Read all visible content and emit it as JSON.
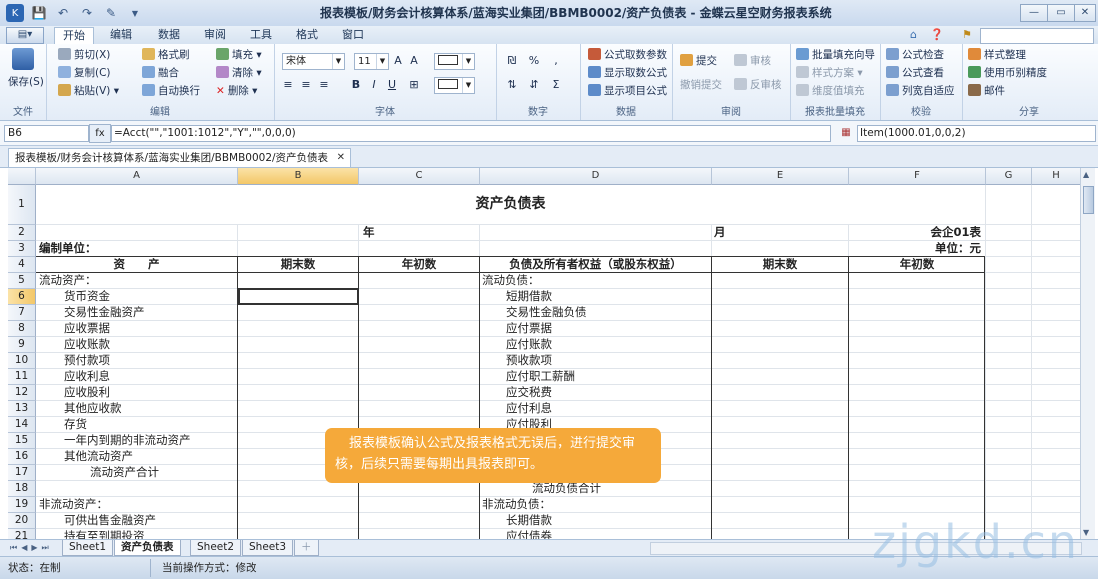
{
  "window": {
    "title": "报表模板/财务会计核算体系/蓝海实业集团/BBMB0002/资产负债表 - 金蝶云星空财务报表系统",
    "minimize": "—",
    "restore": "▭",
    "close": "✕"
  },
  "menu": {
    "app_button": "▤▾",
    "items": [
      "开始",
      "编辑",
      "数据",
      "审阅",
      "工具",
      "格式",
      "窗口"
    ],
    "active": "开始"
  },
  "ribbon": {
    "file": {
      "save": "保存(S)",
      "label": "文件"
    },
    "edit": {
      "cut": "剪切(X)",
      "copy": "复制(C)",
      "paste": "粘贴(V)",
      "format_painter": "格式刷",
      "merge": "融合",
      "wrap": "自动换行",
      "fill": "填充",
      "clear": "清除",
      "delete": "删除",
      "label": "编辑"
    },
    "font": {
      "name": "宋体",
      "size": "11",
      "bold": "B",
      "italic": "I",
      "underline": "U",
      "label": "字体"
    },
    "number": {
      "percent": "%",
      "comma": ",",
      "sum": "Σ",
      "label": "数字"
    },
    "data": {
      "param": "公式取数参数",
      "show_data": "显示取数公式",
      "show_item": "显示项目公式",
      "label": "数据"
    },
    "review": {
      "submit": "提交",
      "audit": "审核",
      "retract": "撤销提交",
      "unaudit": "反审核",
      "label": "审阅"
    },
    "batch": {
      "wizard": "批量填充向导",
      "style": "样式方案",
      "dim": "维度值填充",
      "label": "报表批量填充"
    },
    "check": {
      "formula_check": "公式检查",
      "formula_view": "公式查看",
      "autofit": "列宽自适应",
      "label": "校验"
    },
    "share": {
      "style_clean": "样式整理",
      "currency": "使用币别精度",
      "mail": "邮件",
      "label": "分享"
    }
  },
  "formula": {
    "cell_ref": "B6",
    "fx": "fx",
    "content": "=Acct(\"\",\"1001:1012\",\"Y\",\"\",0,0,0)",
    "right_content": "Item(1000.01,0,0,2)"
  },
  "doc_tab": {
    "label": "报表模板/财务会计核算体系/蓝海实业集团/BBMB0002/资产负债表",
    "close": "✕"
  },
  "sheet": {
    "columns": [
      "A",
      "B",
      "C",
      "D",
      "E",
      "F",
      "G",
      "H"
    ],
    "selected_col": "B",
    "selected_row": "6",
    "rows": [
      "1",
      "2",
      "3",
      "4",
      "5",
      "6",
      "7",
      "8",
      "9",
      "10",
      "11",
      "12",
      "13",
      "14",
      "15",
      "16",
      "17",
      "18",
      "19",
      "20",
      "21"
    ],
    "title": "资产负债表",
    "year_label": "年",
    "month_label": "月",
    "form_code": "会企01表",
    "unit": "单位：元",
    "compiler": "编制单位：",
    "headers": {
      "asset": "资　　产",
      "end": "期末数",
      "begin": "年初数",
      "liab": "负债及所有者权益（或股东权益）",
      "end2": "期末数",
      "begin2": "年初数"
    },
    "left_items": [
      "流动资产：",
      "货币资金",
      "交易性金融资产",
      "应收票据",
      "应收账款",
      "预付款项",
      "应收利息",
      "应收股利",
      "其他应收款",
      "存货",
      "一年内到期的非流动资产",
      "其他流动资产",
      "流动资产合计",
      "",
      "非流动资产：",
      "可供出售金融资产",
      "持有至到期投资"
    ],
    "right_items": [
      "流动负债：",
      "短期借款",
      "交易性金融负债",
      "应付票据",
      "应付账款",
      "预收款项",
      "应付职工薪酬",
      "应交税费",
      "应付利息",
      "应付股利",
      "",
      "",
      "",
      "流动负债合计",
      "非流动负债：",
      "长期借款",
      "应付债券"
    ]
  },
  "sheet_tabs": [
    "Sheet1",
    "资产负债表",
    "Sheet2",
    "Sheet3"
  ],
  "active_sheet": "资产负债表",
  "status": {
    "state": "状态：在制",
    "mode": "当前操作方式：修改"
  },
  "callout": "报表模板确认公式及报表格式无误后，进行提交审核，后续只需要每期出具报表即可。",
  "watermark": "zjgkd.cn",
  "colors": {
    "accent": "#f5a93a",
    "ribbon_bg": "#e3ecf7",
    "selection": "#f3c768"
  }
}
